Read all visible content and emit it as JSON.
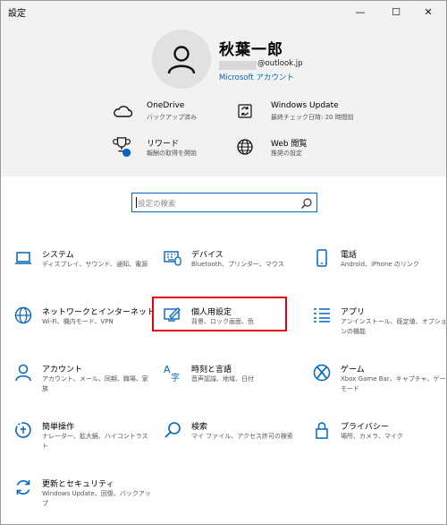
{
  "window": {
    "title": "設定",
    "minimize": "—",
    "maximize": "☐",
    "close": "✕"
  },
  "user": {
    "name": "秋葉一郎",
    "email": "@outlook.jp",
    "account_link": "Microsoft アカウント"
  },
  "header_items": {
    "onedrive": {
      "title": "OneDrive",
      "sub": "バックアップ済み",
      "icon": "cloud-icon"
    },
    "windows_update": {
      "title": "Windows Update",
      "sub": "最終チェック日時: 20 時間前",
      "icon": "refresh-icon"
    },
    "rewards": {
      "title": "リワード",
      "sub": "報酬の取得を開始",
      "icon": "trophy-icon"
    },
    "web_browsing": {
      "title": "Web 閲覧",
      "sub": "推奨の設定",
      "icon": "globe-icon"
    }
  },
  "search": {
    "placeholder": "設定の検索"
  },
  "categories": {
    "system": {
      "title": "システム",
      "desc": "ディスプレイ、サウンド、通知、電源",
      "icon": "laptop-icon"
    },
    "devices": {
      "title": "デバイス",
      "desc": "Bluetooth、プリンター、マウス",
      "icon": "keyboard-icon"
    },
    "phone": {
      "title": "電話",
      "desc": "Android、iPhone のリンク",
      "icon": "phone-icon"
    },
    "network": {
      "title": "ネットワークとインターネット",
      "desc": "Wi-Fi、機内モード、VPN",
      "icon": "globe-icon"
    },
    "personalization": {
      "title": "個人用設定",
      "desc": "背景、ロック画面、色",
      "icon": "paint-icon"
    },
    "apps": {
      "title": "アプリ",
      "desc": "アンインストール、既定値、オプションの機能",
      "icon": "apps-list-icon"
    },
    "accounts": {
      "title": "アカウント",
      "desc": "アカウント、メール、同期、職場、家族",
      "icon": "person-icon"
    },
    "time_language": {
      "title": "時刻と言語",
      "desc": "音声認識、地域、日付",
      "icon": "language-icon"
    },
    "gaming": {
      "title": "ゲーム",
      "desc": "Xbox Game Bar、キャプチャ、ゲーム モード",
      "icon": "xbox-icon"
    },
    "ease_of_access": {
      "title": "簡単操作",
      "desc": "ナレーター、拡大鏡、ハイコントラスト",
      "icon": "ease-icon"
    },
    "search": {
      "title": "検索",
      "desc": "マイ ファイル、アクセス許可の検索",
      "icon": "search-icon"
    },
    "privacy": {
      "title": "プライバシー",
      "desc": "場所、カメラ、マイク",
      "icon": "lock-icon"
    },
    "update_security": {
      "title": "更新とセキュリティ",
      "desc": "Windows Update、回復、バックアップ",
      "icon": "sync-icon"
    }
  },
  "colors": {
    "accent": "#0067c0",
    "highlight_border": "#e60012",
    "header_bg": "#f2f2f2"
  }
}
